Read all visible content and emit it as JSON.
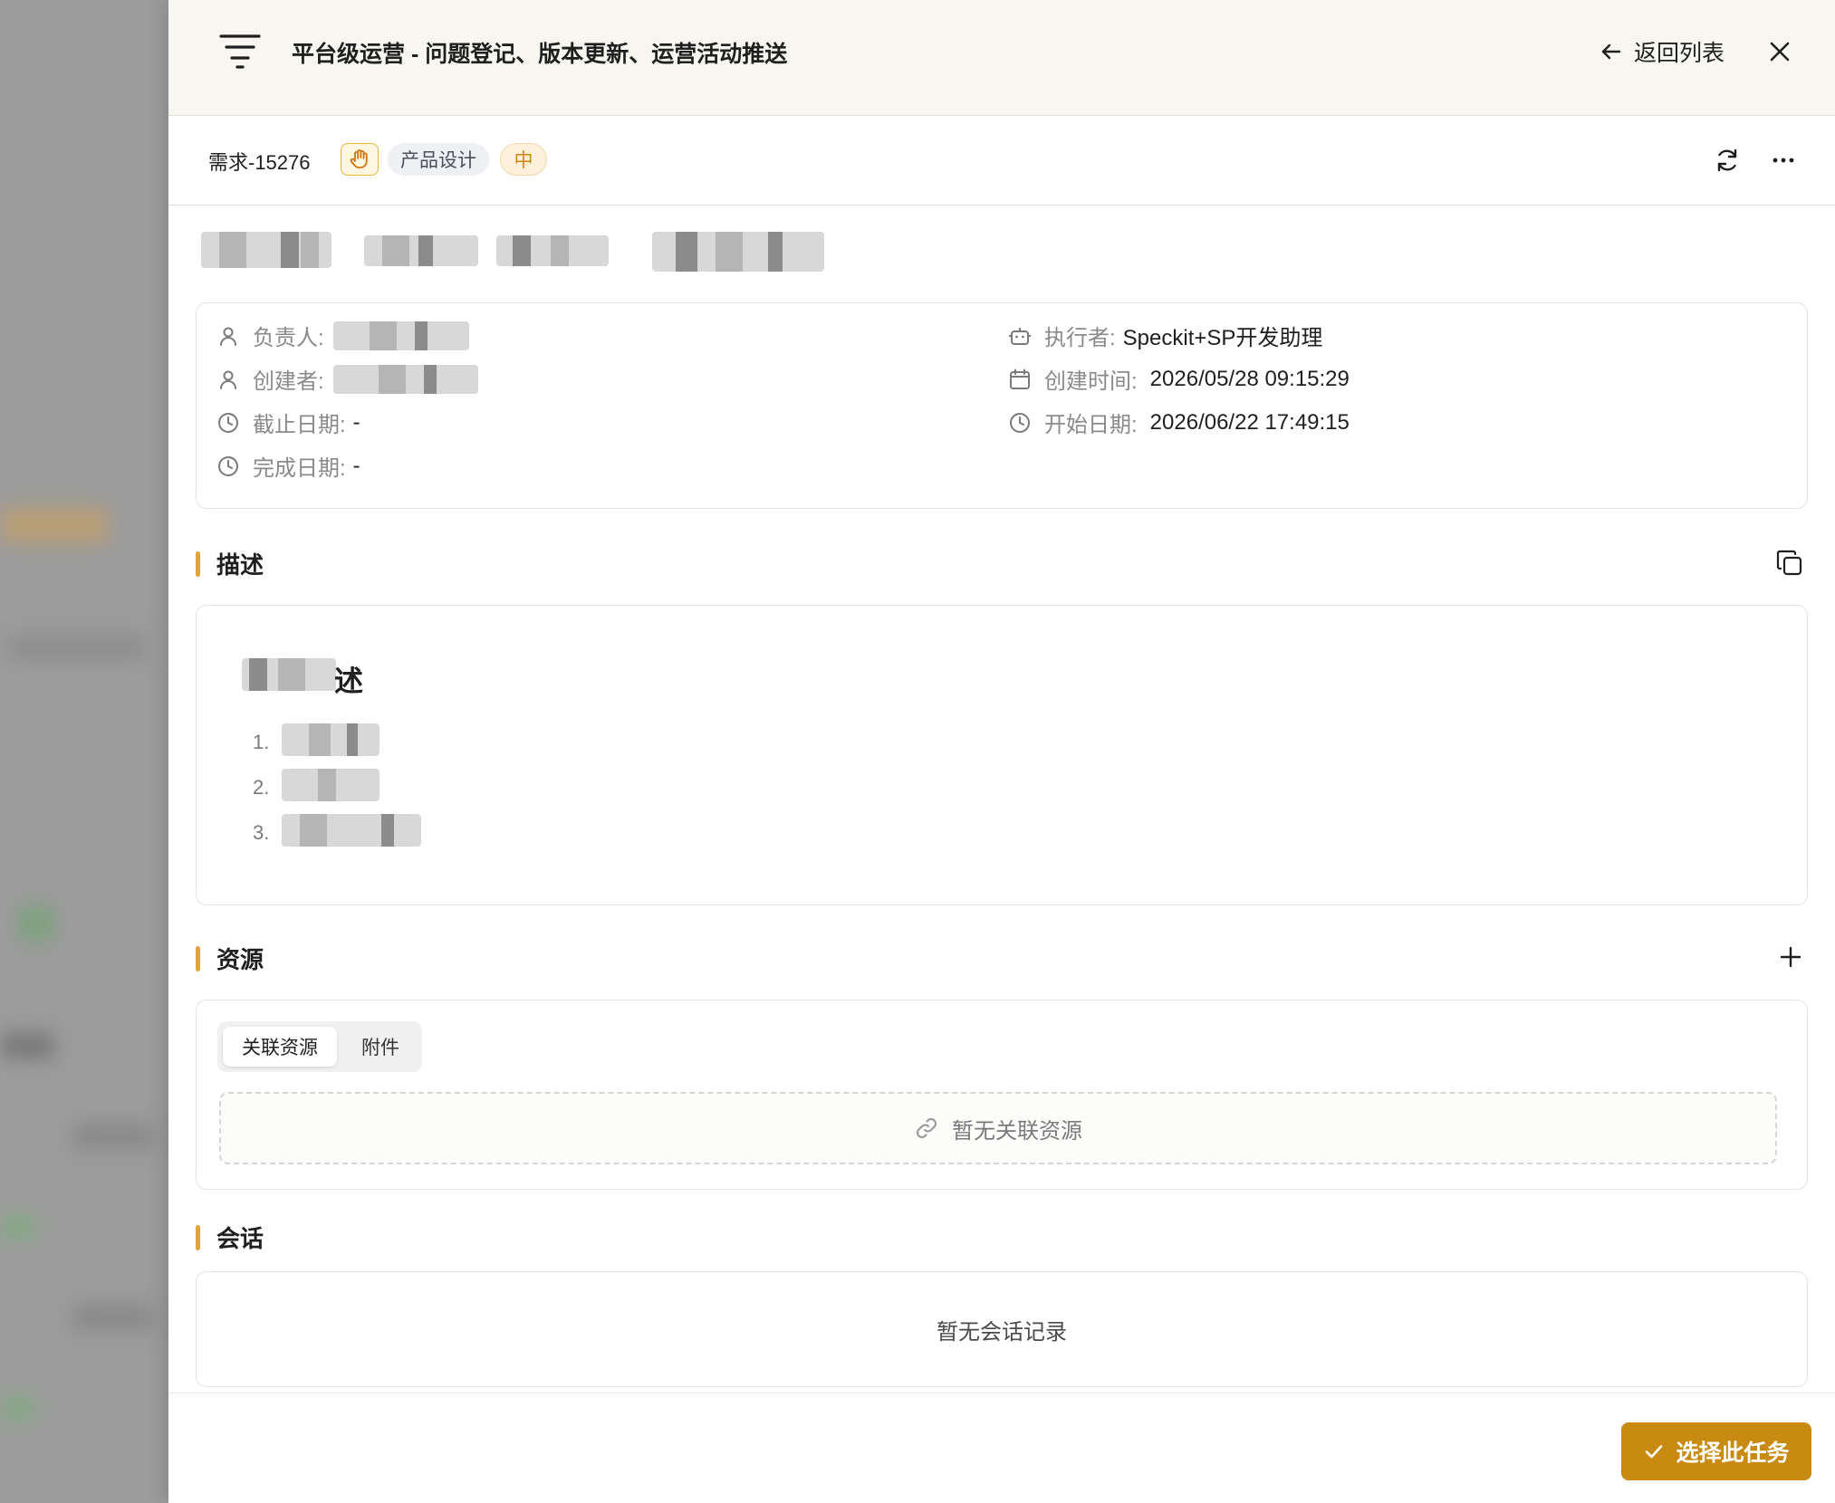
{
  "header": {
    "title": "平台级运营 - 问题登记、版本更新、运营活动推送",
    "back_label": "返回列表"
  },
  "subheader": {
    "req_id": "需求-15276",
    "tag_design": "产品设计",
    "tag_priority": "中"
  },
  "info": {
    "owner_label": "负责人:",
    "creator_label": "创建者:",
    "deadline_label": "截止日期:",
    "deadline_value": "-",
    "completed_label": "完成日期:",
    "completed_value": "-",
    "executor_label": "执行者:",
    "executor_value": "Speckit+SP开发助理",
    "created_time_label": "创建时间:",
    "created_time_value": "2026/05/28 09:15:29",
    "start_date_label": "开始日期:",
    "start_date_value": "2026/06/22 17:49:15"
  },
  "description": {
    "section_title": "描述",
    "heading_suffix": "述",
    "list_numbers": [
      "1.",
      "2.",
      "3."
    ]
  },
  "resources": {
    "section_title": "资源",
    "tab_linked": "关联资源",
    "tab_attachment": "附件",
    "empty_text": "暂无关联资源"
  },
  "conversation": {
    "section_title": "会话",
    "empty_text": "暂无会话记录"
  },
  "footer": {
    "select_label": "选择此任务"
  },
  "colors": {
    "accent": "#c98a12",
    "section_bar": "#e0a43c",
    "priority_text": "#d1870e"
  }
}
